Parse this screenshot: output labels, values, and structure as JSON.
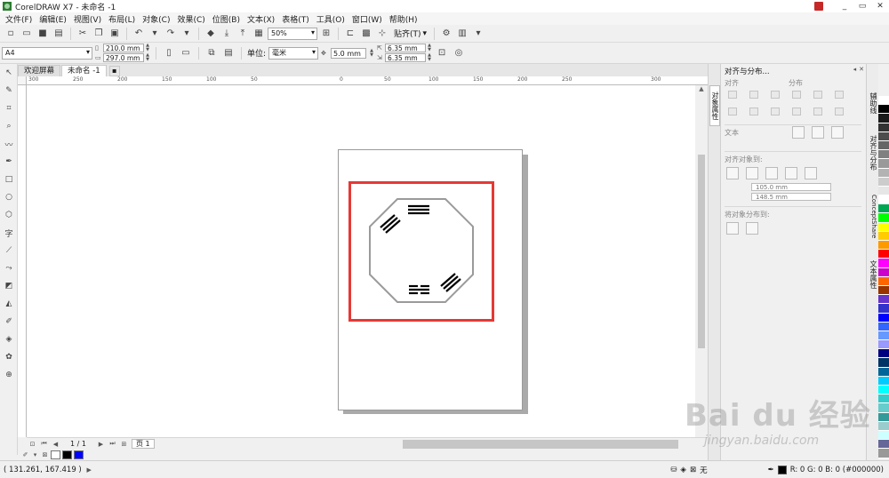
{
  "window": {
    "title": "CorelDRAW X7 - 未命名 -1",
    "controls": [
      "_",
      "▭",
      "✕"
    ]
  },
  "menu": [
    "文件(F)",
    "编辑(E)",
    "视图(V)",
    "布局(L)",
    "对象(C)",
    "效果(C)",
    "位图(B)",
    "文本(X)",
    "表格(T)",
    "工具(O)",
    "窗口(W)",
    "帮助(H)"
  ],
  "toolbar": {
    "zoom": "50%",
    "snap_label": "贴齐(T)"
  },
  "property_bar": {
    "page_size": "A4",
    "width": "210.0 mm",
    "height": "297.0 mm",
    "unit_label": "单位:",
    "unit": "毫米",
    "nudge": "5.0 mm",
    "dup_x": "6.35 mm",
    "dup_y": "6.35 mm"
  },
  "doc_tabs": [
    {
      "label": "欢迎屏幕",
      "active": false
    },
    {
      "label": "未命名 -1",
      "active": true
    }
  ],
  "ruler_h_ticks": [
    "300",
    "250",
    "200",
    "150",
    "100",
    "50",
    "0",
    "50",
    "100",
    "150",
    "200",
    "250",
    "300"
  ],
  "page_nav": {
    "count": "1 / 1",
    "page_tab": "页 1"
  },
  "status": {
    "coords": "( 131.261, 167.419 )",
    "fill_none": "无",
    "outline_info": "R: 0 G: 0 B: 0 (#000000)"
  },
  "align_panel": {
    "title": "对齐与分布...",
    "sec_align": "对齐",
    "sec_distribute": "分布",
    "sec_text": "文本",
    "sec_align_to": "对齐对象到:",
    "field_x": "105.0 mm",
    "field_y": "148.5 mm",
    "sec_distribute_to": "将对象分布到:"
  },
  "dock_tab": "对象属性",
  "side_tabs": [
    "辅助线",
    "对齐与分布",
    "ConceptShare",
    "文本属性"
  ],
  "palette_colors": [
    "#ffffff",
    "#000000",
    "#1a1a1a",
    "#333333",
    "#4d4d4d",
    "#666666",
    "#808080",
    "#999999",
    "#b3b3b3",
    "#cccccc",
    "#e6e6e6",
    "#ffffff",
    "#00a651",
    "#00ff00",
    "#ffff00",
    "#ffcc00",
    "#ff9900",
    "#ff0000",
    "#ff00ff",
    "#cc00cc",
    "#ff6600",
    "#993300",
    "#6633cc",
    "#3333cc",
    "#0000ff",
    "#3366ff",
    "#6699ff",
    "#9999ff",
    "#000080",
    "#003366",
    "#006699",
    "#00ccff",
    "#00ffff",
    "#33cccc",
    "#66cccc",
    "#339999",
    "#99cccc",
    "#ccffff",
    "#666699",
    "#999999"
  ],
  "doc_palette": [
    "#ffffff",
    "#000000",
    "#0000ff"
  ],
  "watermark": {
    "main": "Bai du 经验",
    "sub": "jingyan.baidu.com"
  }
}
